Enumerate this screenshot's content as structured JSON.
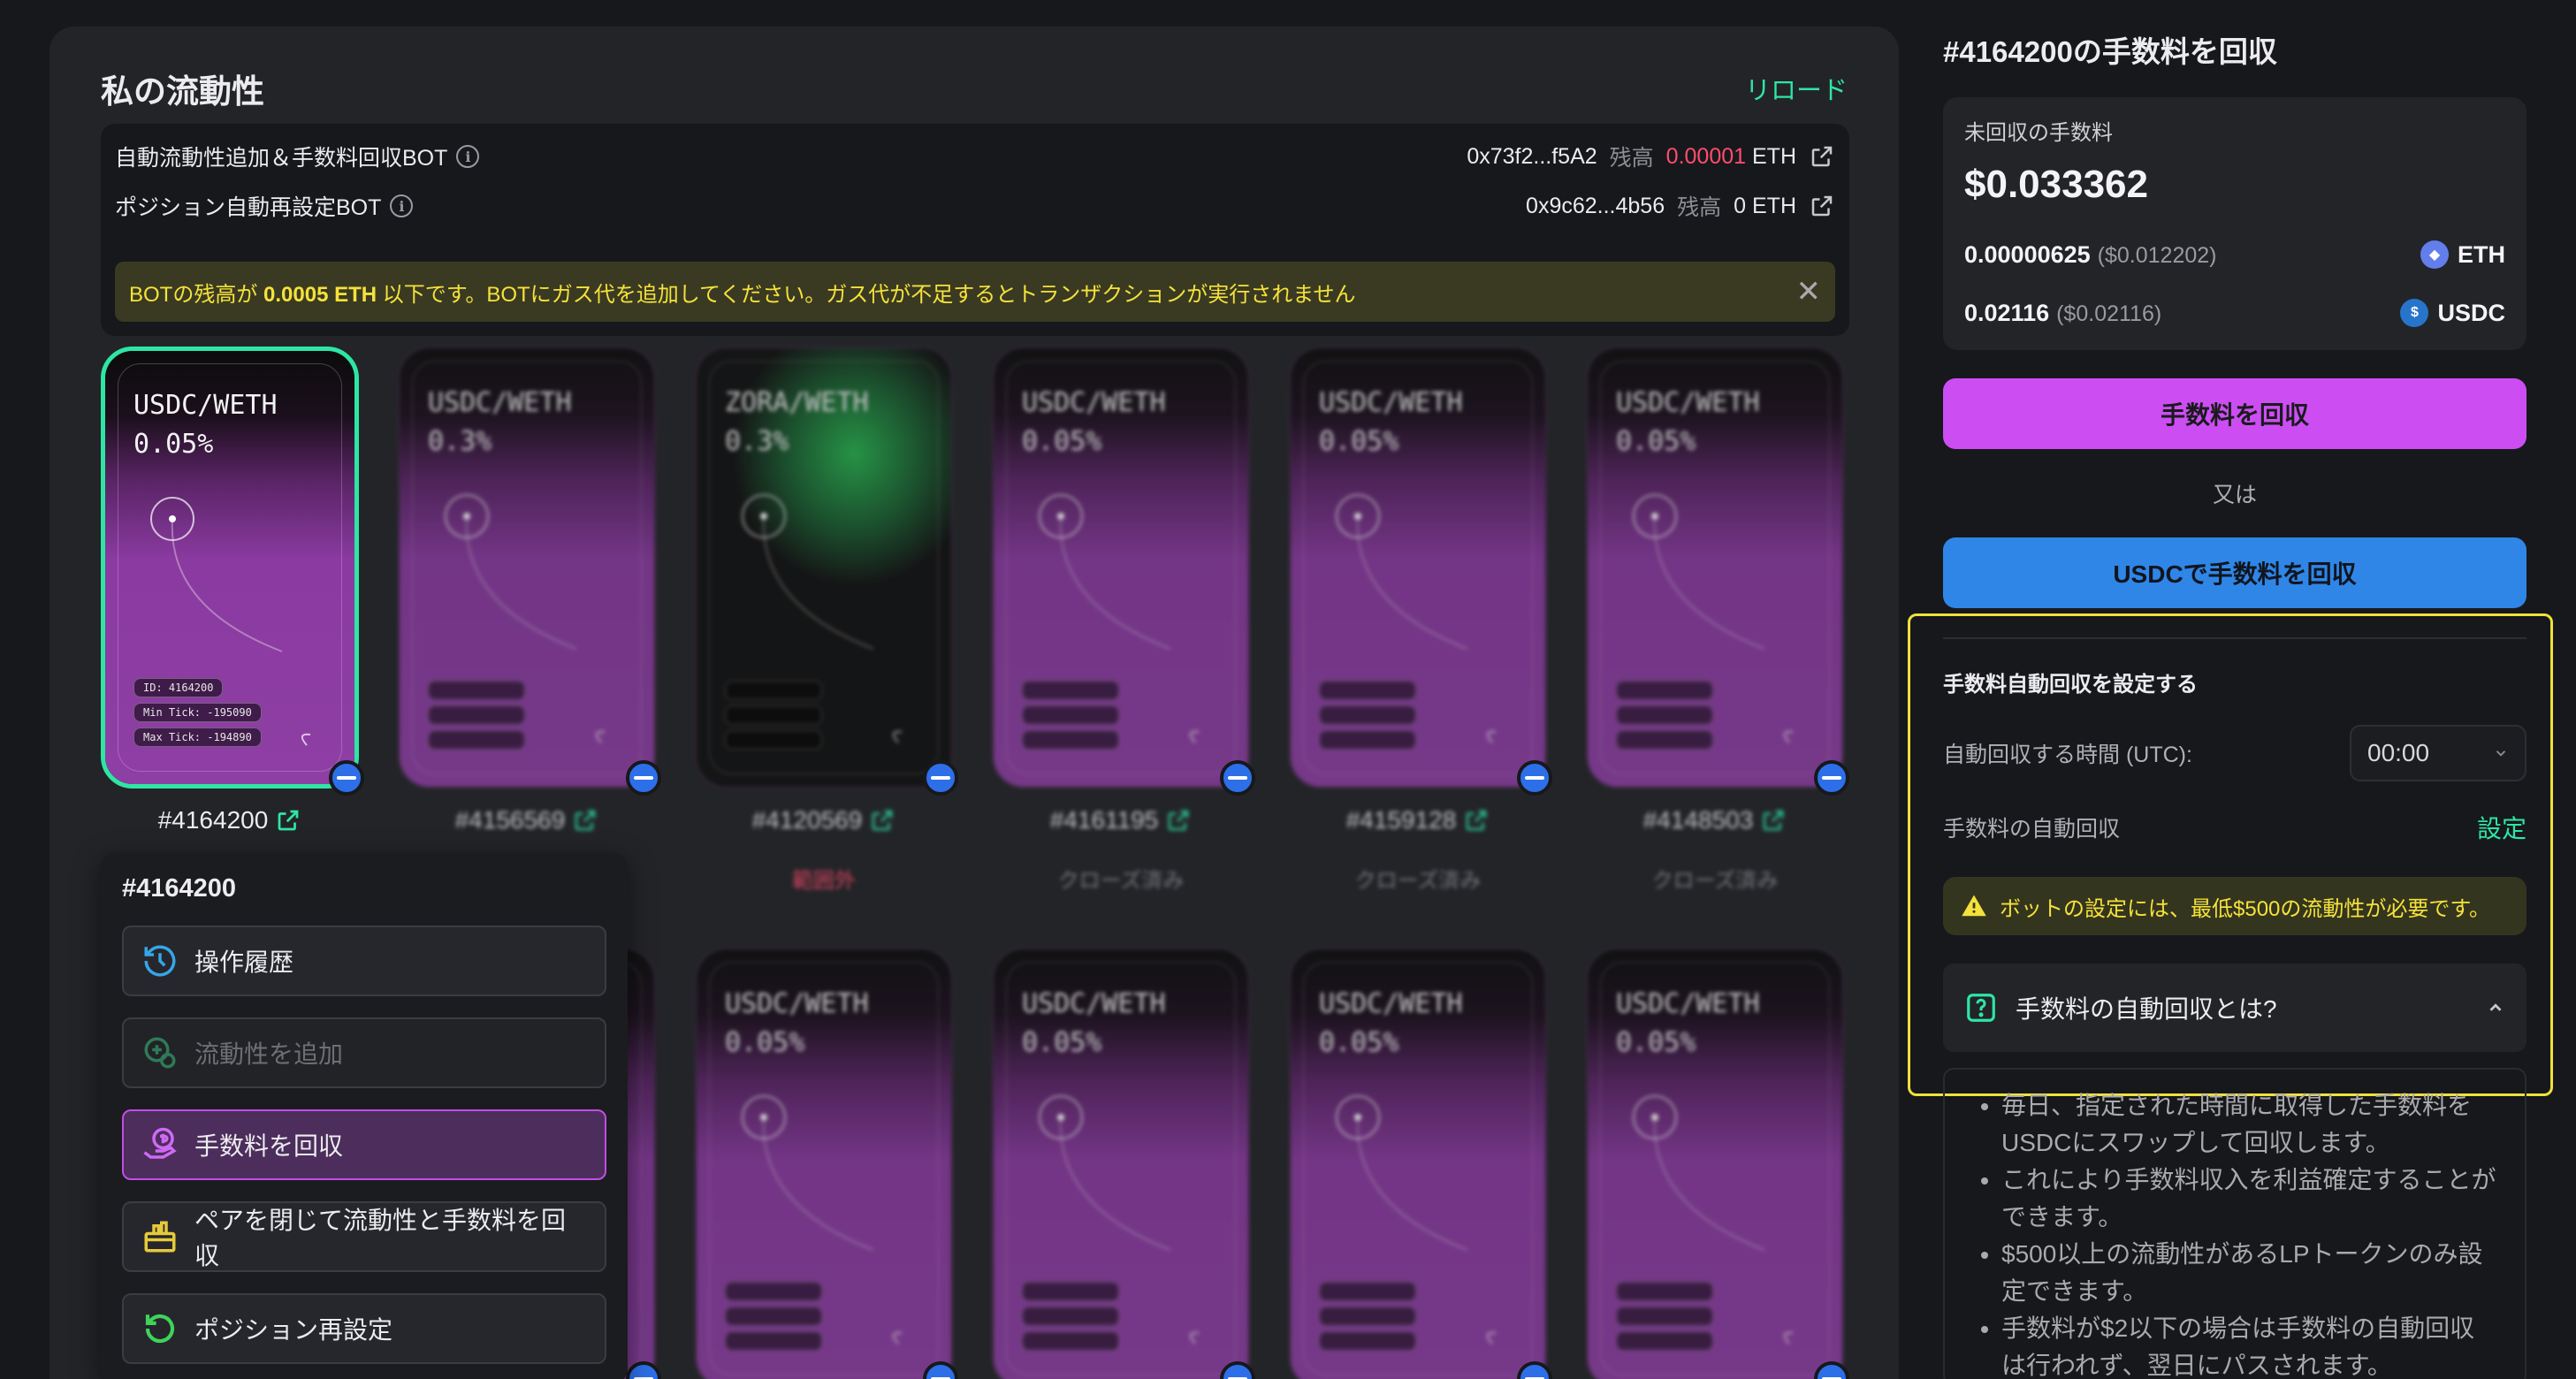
{
  "left": {
    "title": "私の流動性",
    "reload": "リロード",
    "bots": [
      {
        "label": "自動流動性追加＆手数料回収BOT",
        "address": "0x73f2...f5A2",
        "balance_label": "残高",
        "balance": "0.00001",
        "unit": "ETH",
        "balance_low": true
      },
      {
        "label": "ポジション自動再設定BOT",
        "address": "0x9c62...4b56",
        "balance_label": "残高",
        "balance": "0",
        "unit": "ETH",
        "balance_low": false
      }
    ],
    "warning": {
      "prefix": "BOTの残高が ",
      "amount": "0.0005 ETH",
      "suffix": " 以下です。BOTにガス代を追加してください。ガス代が不足するとトランザクションが実行されません"
    }
  },
  "cards": [
    {
      "pair": "USDC/WETH",
      "fee": "0.05%",
      "id": "#4164200",
      "status": "",
      "theme": "purple",
      "chips": [
        "ID: 4164200",
        "Min Tick: -195090",
        "Max Tick: -194890"
      ],
      "selected": true
    },
    {
      "pair": "USDC/WETH",
      "fee": "0.3%",
      "id": "#4156569",
      "status": "",
      "theme": "purple",
      "chips": []
    },
    {
      "pair": "ZORA/WETH",
      "fee": "0.3%",
      "id": "#4120569",
      "status": "範囲外",
      "status_red": true,
      "theme": "green",
      "chips": []
    },
    {
      "pair": "USDC/WETH",
      "fee": "0.05%",
      "id": "#4161195",
      "status": "クローズ済み",
      "theme": "purple",
      "chips": []
    },
    {
      "pair": "USDC/WETH",
      "fee": "0.05%",
      "id": "#4159128",
      "status": "クローズ済み",
      "theme": "purple",
      "chips": []
    },
    {
      "pair": "USDC/WETH",
      "fee": "0.05%",
      "id": "#4148503",
      "status": "クローズ済み",
      "theme": "purple",
      "chips": []
    },
    {
      "pair": "",
      "fee": "",
      "id": "",
      "status": "",
      "theme": "purple",
      "chips": []
    },
    {
      "pair": "USDC/WETH",
      "fee": "0.05%",
      "id": "",
      "status": "",
      "theme": "purple",
      "chips": []
    },
    {
      "pair": "USDC/WETH",
      "fee": "0.05%",
      "id": "",
      "status": "",
      "theme": "purple",
      "chips": []
    },
    {
      "pair": "USDC/WETH",
      "fee": "0.05%",
      "id": "",
      "status": "",
      "theme": "purple",
      "chips": []
    },
    {
      "pair": "USDC/WETH",
      "fee": "0.05%",
      "id": "",
      "status": "",
      "theme": "purple",
      "chips": []
    }
  ],
  "menu": {
    "title": "#4164200",
    "items": [
      {
        "label": "操作履歴",
        "icon": "history-icon",
        "state": "normal"
      },
      {
        "label": "流動性を追加",
        "icon": "add-liquidity-icon",
        "state": "disabled"
      },
      {
        "label": "手数料を回収",
        "icon": "collect-fee-icon",
        "state": "active"
      },
      {
        "label": "ペアを閉じて流動性と手数料を回収",
        "icon": "close-pair-icon",
        "state": "normal"
      },
      {
        "label": "ポジション再設定",
        "icon": "reset-position-icon",
        "state": "normal"
      }
    ]
  },
  "right": {
    "title": "#4164200の手数料を回収",
    "unclaimed_label": "未回収の手数料",
    "total": "$0.033362",
    "tokens": [
      {
        "amount": "0.00000625",
        "usd": "($0.012202)",
        "symbol": "ETH",
        "icon": "eth-icon"
      },
      {
        "amount": "0.02116",
        "usd": "($0.02116)",
        "symbol": "USDC",
        "icon": "usdc-icon"
      }
    ],
    "collect_button": "手数料を回収",
    "or": "又は",
    "collect_usdc_button": "USDCで手数料を回収",
    "auto": {
      "title": "手数料自動回収を設定する",
      "time_label": "自動回収する時間 (UTC):",
      "time_value": "00:00",
      "auto_label": "手数料の自動回収",
      "setting_link": "設定",
      "note": "ボットの設定には、最低$500の流動性が必要です。",
      "faq_title": "手数料の自動回収とは?",
      "faq_items": [
        "毎日、指定された時間に取得した手数料をUSDCにスワップして回収します。",
        "これにより手数料収入を利益確定することができます。",
        "$500以上の流動性があるLPトークンのみ設定できます。",
        "手数料が$2以下の場合は手数料の自動回収は行われず、翌日にパスされます。"
      ]
    }
  },
  "colors": {
    "accent_green": "#2ee6a4",
    "purple_button": "#cc4ef2",
    "blue_button": "#2f86e6",
    "warning_yellow": "#f5e23a",
    "alert_red": "#ff4d6d"
  }
}
